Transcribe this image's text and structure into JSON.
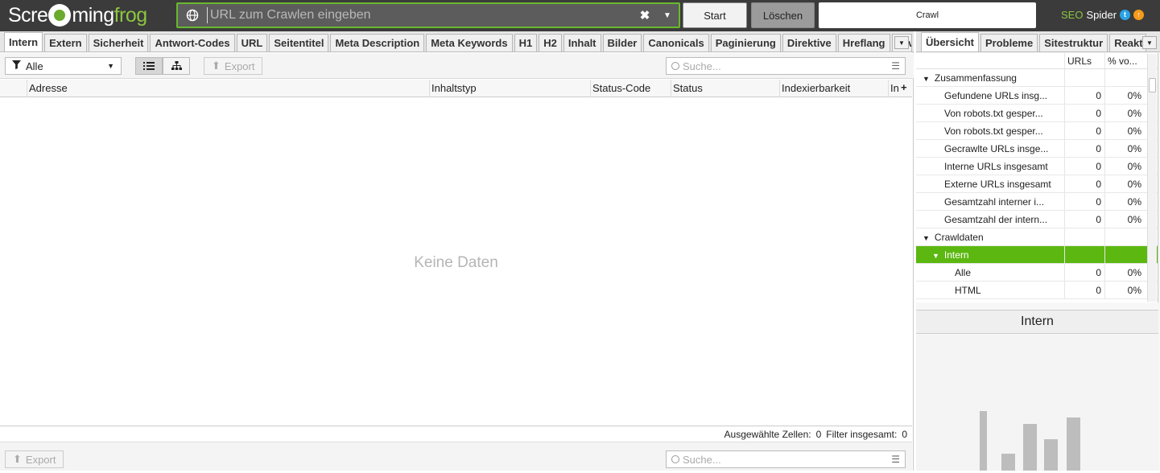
{
  "app": {
    "logo_text_white": "Scre",
    "logo_text_white2": "ming",
    "logo_text_green": "frog",
    "brand_seo": "SEO",
    "brand_spider": "Spider"
  },
  "topbar": {
    "url_placeholder": "URL zum Crawlen eingeben",
    "start_label": "Start",
    "clear_label": "Löschen",
    "mode_label": "Crawl"
  },
  "tabs": [
    {
      "label": "Intern",
      "active": true
    },
    {
      "label": "Extern"
    },
    {
      "label": "Sicherheit"
    },
    {
      "label": "Antwort-Codes"
    },
    {
      "label": "URL"
    },
    {
      "label": "Seitentitel"
    },
    {
      "label": "Meta Description"
    },
    {
      "label": "Meta Keywords"
    },
    {
      "label": "H1"
    },
    {
      "label": "H2"
    },
    {
      "label": "Inhalt"
    },
    {
      "label": "Bilder"
    },
    {
      "label": "Canonicals"
    },
    {
      "label": "Paginierung"
    },
    {
      "label": "Direktive"
    },
    {
      "label": "Hreflang"
    },
    {
      "label": "JavaScri"
    }
  ],
  "toolbar": {
    "filter_value": "Alle",
    "export_label": "Export",
    "search_placeholder": "Suche..."
  },
  "columns": [
    "Adresse",
    "Inhaltstyp",
    "Status-Code",
    "Status",
    "Indexierbarkeit",
    "In"
  ],
  "main": {
    "empty_text": "Keine Daten",
    "selected_cells_label": "Ausgewählte Zellen:",
    "selected_cells_value": "0",
    "filter_total_label": "Filter insgesamt:",
    "filter_total_value": "0"
  },
  "bottom": {
    "export_label": "Export",
    "search_placeholder": "Suche..."
  },
  "right": {
    "tabs": [
      "Übersicht",
      "Probleme",
      "Sitestruktur",
      "Reakti"
    ],
    "col_urls": "URLs",
    "col_pct": "% vo...",
    "rows": [
      {
        "label": "Zusammenfassung",
        "type": "section"
      },
      {
        "label": "Gefundene URLs insg...",
        "urls": "0",
        "pct": "0%"
      },
      {
        "label": "Von robots.txt gesper...",
        "urls": "0",
        "pct": "0%"
      },
      {
        "label": "Von robots.txt gesper...",
        "urls": "0",
        "pct": "0%"
      },
      {
        "label": "Gecrawlte URLs insge...",
        "urls": "0",
        "pct": "0%"
      },
      {
        "label": "Interne URLs insgesamt",
        "urls": "0",
        "pct": "0%"
      },
      {
        "label": "Externe URLs insgesamt",
        "urls": "0",
        "pct": "0%"
      },
      {
        "label": "Gesamtzahl interner i...",
        "urls": "0",
        "pct": "0%"
      },
      {
        "label": "Gesamtzahl der intern...",
        "urls": "0",
        "pct": "0%"
      },
      {
        "label": "Crawldaten",
        "type": "section"
      },
      {
        "label": "Intern",
        "type": "sub",
        "selected": true
      },
      {
        "label": "Alle",
        "type": "leaf",
        "urls": "0",
        "pct": "0%"
      },
      {
        "label": "HTML",
        "type": "leaf",
        "urls": "0",
        "pct": "0%"
      }
    ],
    "detail_title": "Intern"
  }
}
